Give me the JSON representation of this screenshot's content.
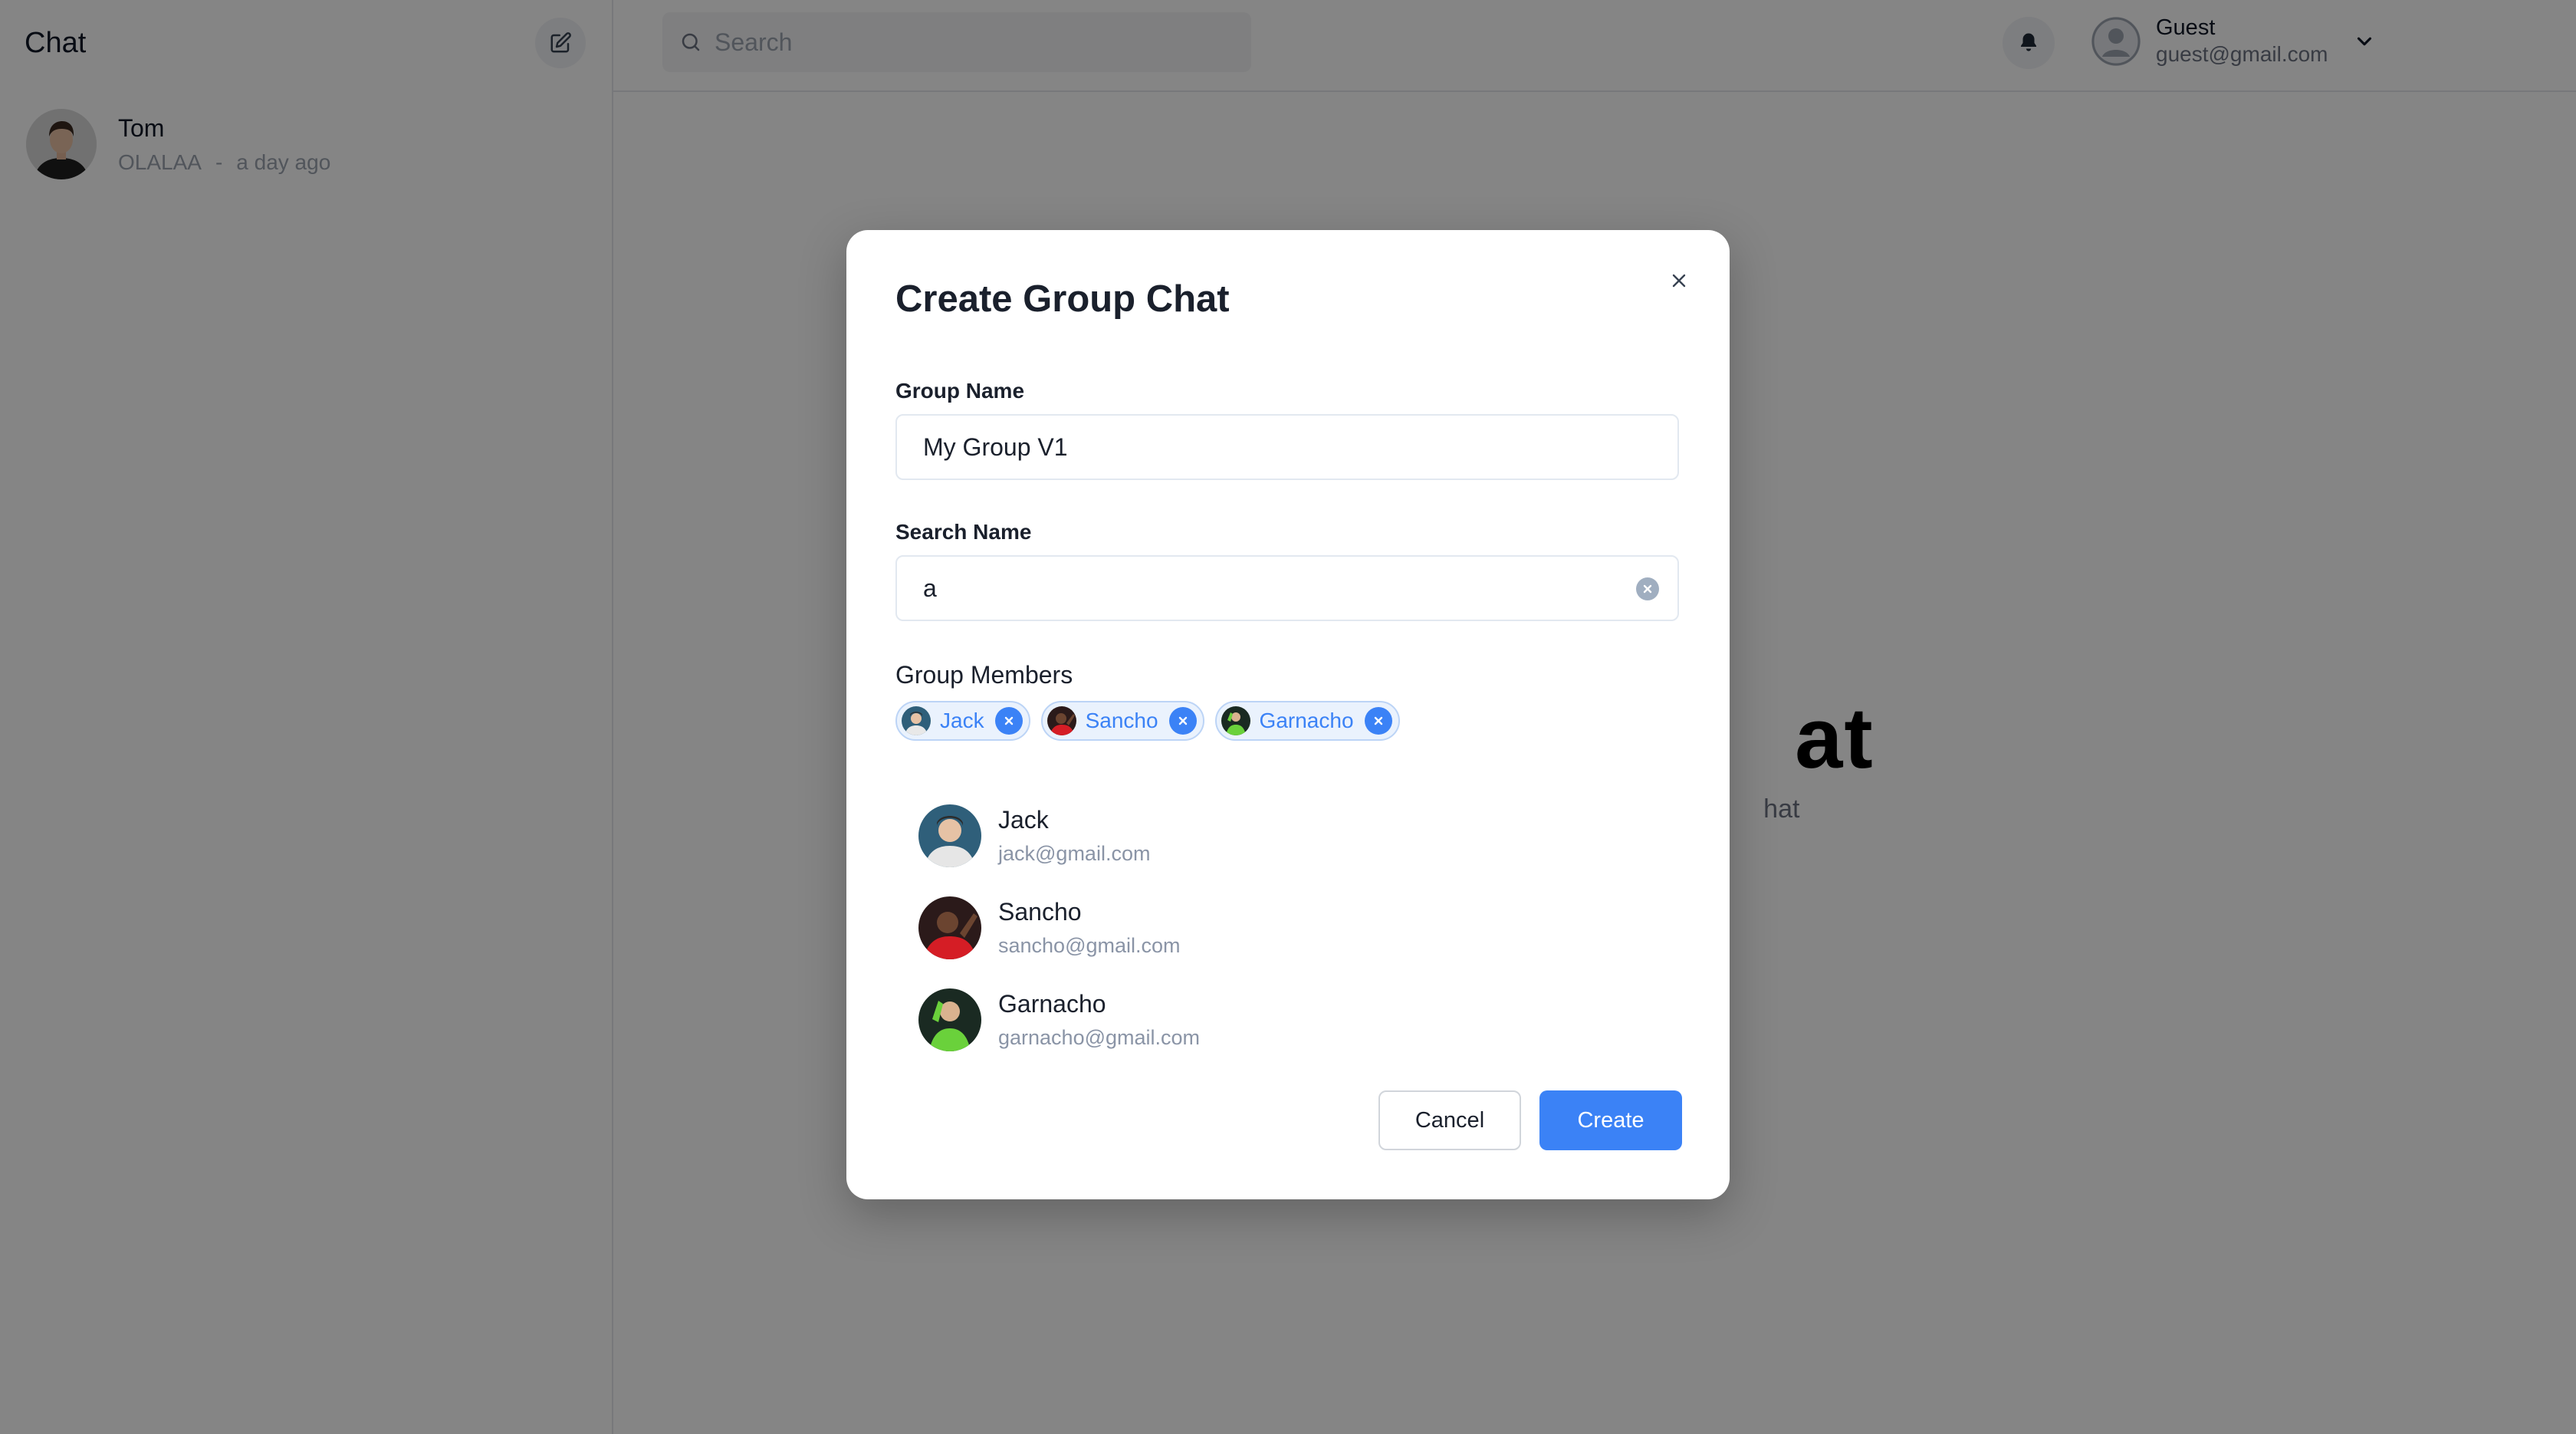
{
  "sidebar": {
    "title": "Chat",
    "compose_icon": "compose-icon",
    "chats": [
      {
        "name": "Tom",
        "last_message": "OLALAA",
        "separator": "-",
        "time": "a day ago"
      }
    ]
  },
  "topbar": {
    "search_placeholder": "Search",
    "search_icon": "search-icon",
    "bell_icon": "bell-icon",
    "user": {
      "name": "Guest",
      "email": "guest@gmail.com"
    }
  },
  "main": {
    "welcome_title_visible": "at",
    "welcome_subtitle_visible": "hat"
  },
  "modal": {
    "title": "Create Group Chat",
    "group_name_label": "Group Name",
    "group_name_value": "My Group V1",
    "search_label": "Search Name",
    "search_value": "a",
    "members_label": "Group Members",
    "members": [
      {
        "name": "Jack"
      },
      {
        "name": "Sancho"
      },
      {
        "name": "Garnacho"
      }
    ],
    "results": [
      {
        "name": "Jack",
        "email": "jack@gmail.com"
      },
      {
        "name": "Sancho",
        "email": "sancho@gmail.com"
      },
      {
        "name": "Garnacho",
        "email": "garnacho@gmail.com"
      }
    ],
    "cancel_label": "Cancel",
    "create_label": "Create"
  },
  "colors": {
    "accent": "#3b82f6",
    "overlay": "rgba(0,0,0,0.48)",
    "chip_bg": "#eaf2fd"
  }
}
